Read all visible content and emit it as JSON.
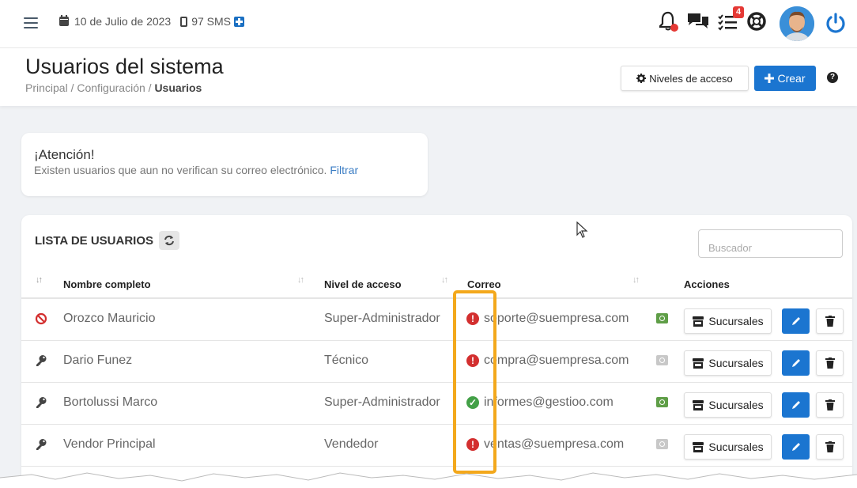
{
  "topbar": {
    "date": "10 de Julio de 2023",
    "sms": "97 SMS",
    "tasks_badge": "4"
  },
  "header": {
    "title": "Usuarios del sistema",
    "breadcrumb_1": "Principal",
    "breadcrumb_sep": "/",
    "breadcrumb_2": "Configuración",
    "breadcrumb_3": "Usuarios",
    "access_levels_label": "Niveles de acceso",
    "create_label": "Crear"
  },
  "alert": {
    "title": "¡Atención!",
    "text": "Existen usuarios que aun no verifican su correo electrónico.",
    "link": "Filtrar"
  },
  "panel": {
    "title": "LISTA DE USUARIOS",
    "search_placeholder": "Buscador",
    "columns": {
      "name": "Nombre completo",
      "level": "Nivel de acceso",
      "email": "Correo",
      "actions": "Acciones"
    },
    "branches_label": "Sucursales"
  },
  "users": [
    {
      "icon": "ban-icon",
      "name": "Orozco Mauricio",
      "level": "Super-Administrador",
      "email": "soporte@suempresa.com",
      "verified": false,
      "photo": true
    },
    {
      "icon": "key-icon",
      "name": "Dario Funez",
      "level": "Técnico",
      "email": "compra@suempresa.com",
      "verified": false,
      "photo": false
    },
    {
      "icon": "key-icon",
      "name": "Bortolussi Marco",
      "level": "Super-Administrador",
      "email": "informes@gestioo.com",
      "verified": true,
      "photo": true
    },
    {
      "icon": "key-icon",
      "name": "Vendor Principal",
      "level": "Vendedor",
      "email": "ventas@suempresa.com",
      "verified": false,
      "photo": false
    }
  ],
  "colors": {
    "primary": "#1b75d0",
    "error": "#d32f2f",
    "success": "#43a047",
    "highlight": "#f3a81c"
  }
}
